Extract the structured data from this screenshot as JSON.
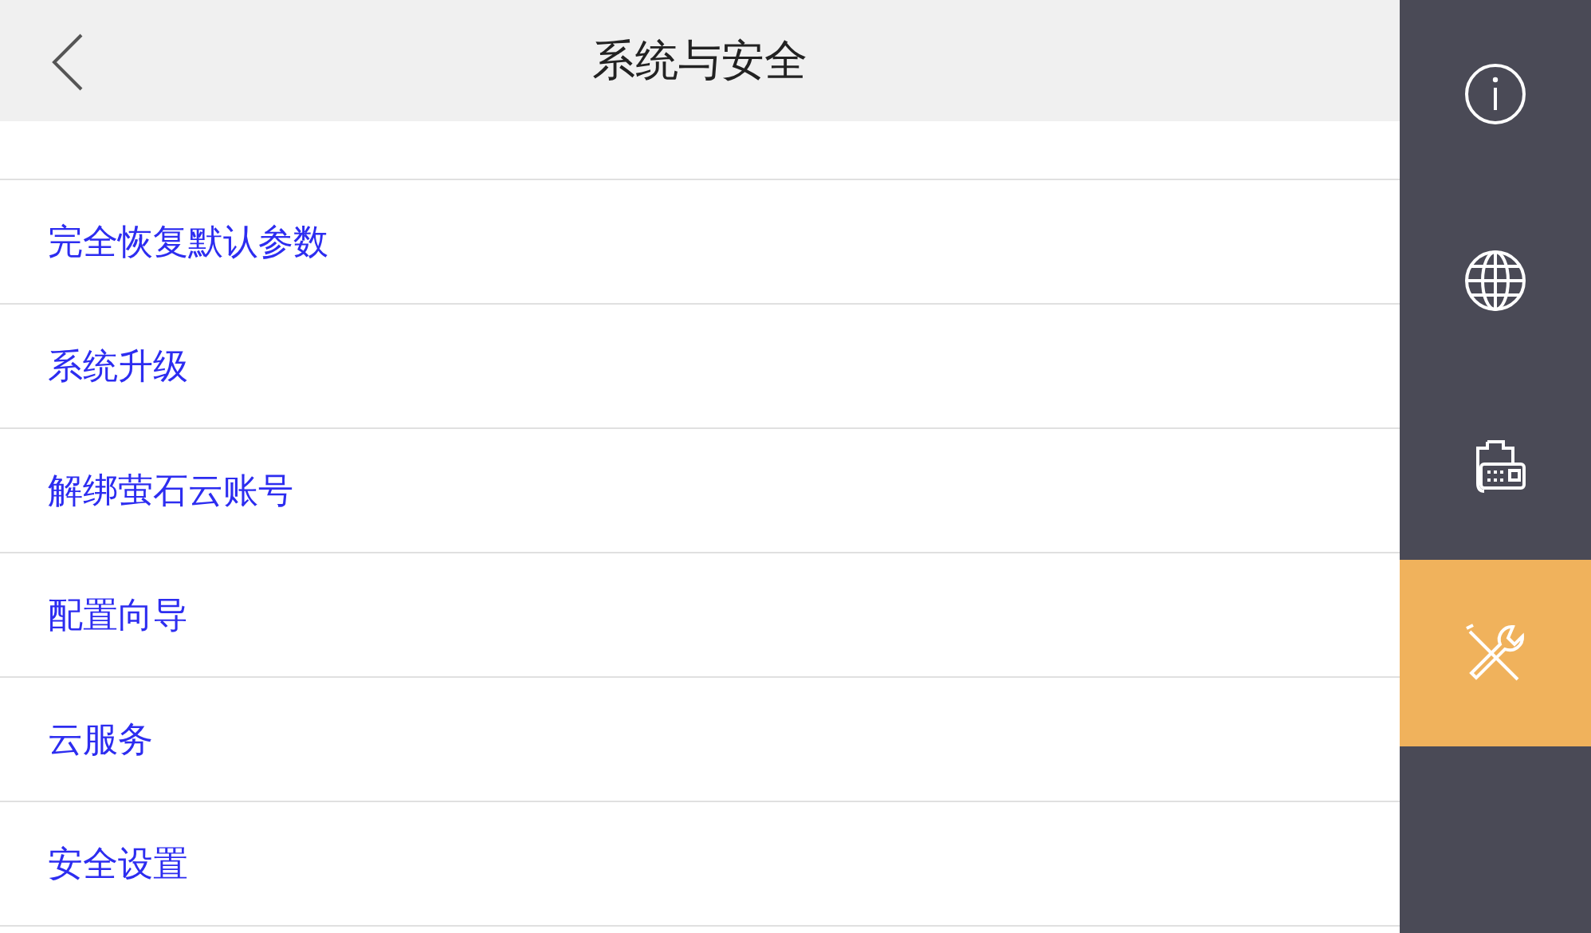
{
  "header": {
    "title": "系统与安全"
  },
  "menu_items": [
    {
      "label": "完全恢复默认参数"
    },
    {
      "label": "系统升级"
    },
    {
      "label": "解绑萤石云账号"
    },
    {
      "label": "配置向导"
    },
    {
      "label": "云服务"
    },
    {
      "label": "安全设置"
    }
  ],
  "sidebar": {
    "items": [
      {
        "kind": "info",
        "selected": false
      },
      {
        "kind": "globe",
        "selected": false
      },
      {
        "kind": "device",
        "selected": false
      },
      {
        "kind": "tools",
        "selected": true
      }
    ]
  }
}
